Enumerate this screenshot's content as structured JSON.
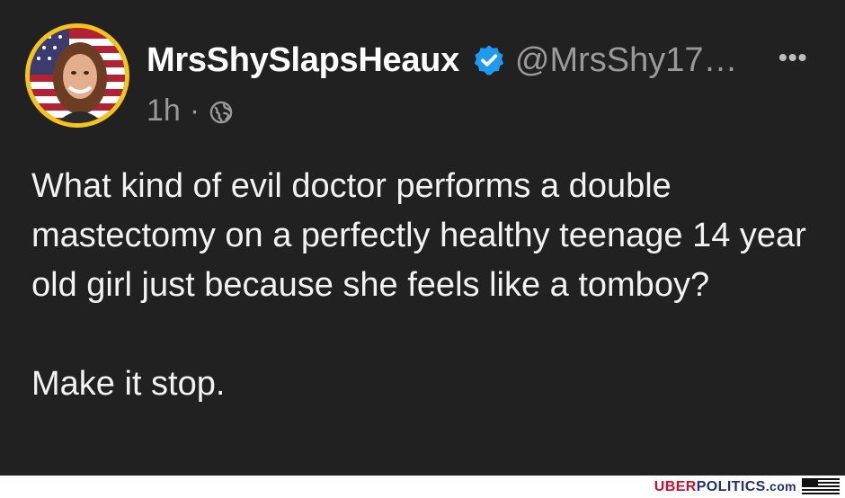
{
  "post": {
    "display_name": "MrsShySlapsHeaux",
    "handle": "@MrsShy17…",
    "time": "1h",
    "separator": "·",
    "more_label": "•••",
    "body_paragraph_1": "What kind of evil doctor performs a double mastectomy on a perfectly healthy teenage 14 year old girl just because she feels like a tomboy?",
    "body_paragraph_2": "Make it stop."
  },
  "footer": {
    "brand_uber": "UBER",
    "brand_politics": "POLITICS",
    "brand_dotcom": ".com"
  },
  "icons": {
    "verified": "verified-badge-icon",
    "globe": "globe-icon",
    "more": "more-options-icon",
    "flag": "us-flag-icon"
  },
  "colors": {
    "background": "#212121",
    "verified_blue": "#1d9bf0",
    "avatar_ring": "#f3c419",
    "brand_red": "#c8102e",
    "brand_blue": "#1c2f7a"
  }
}
